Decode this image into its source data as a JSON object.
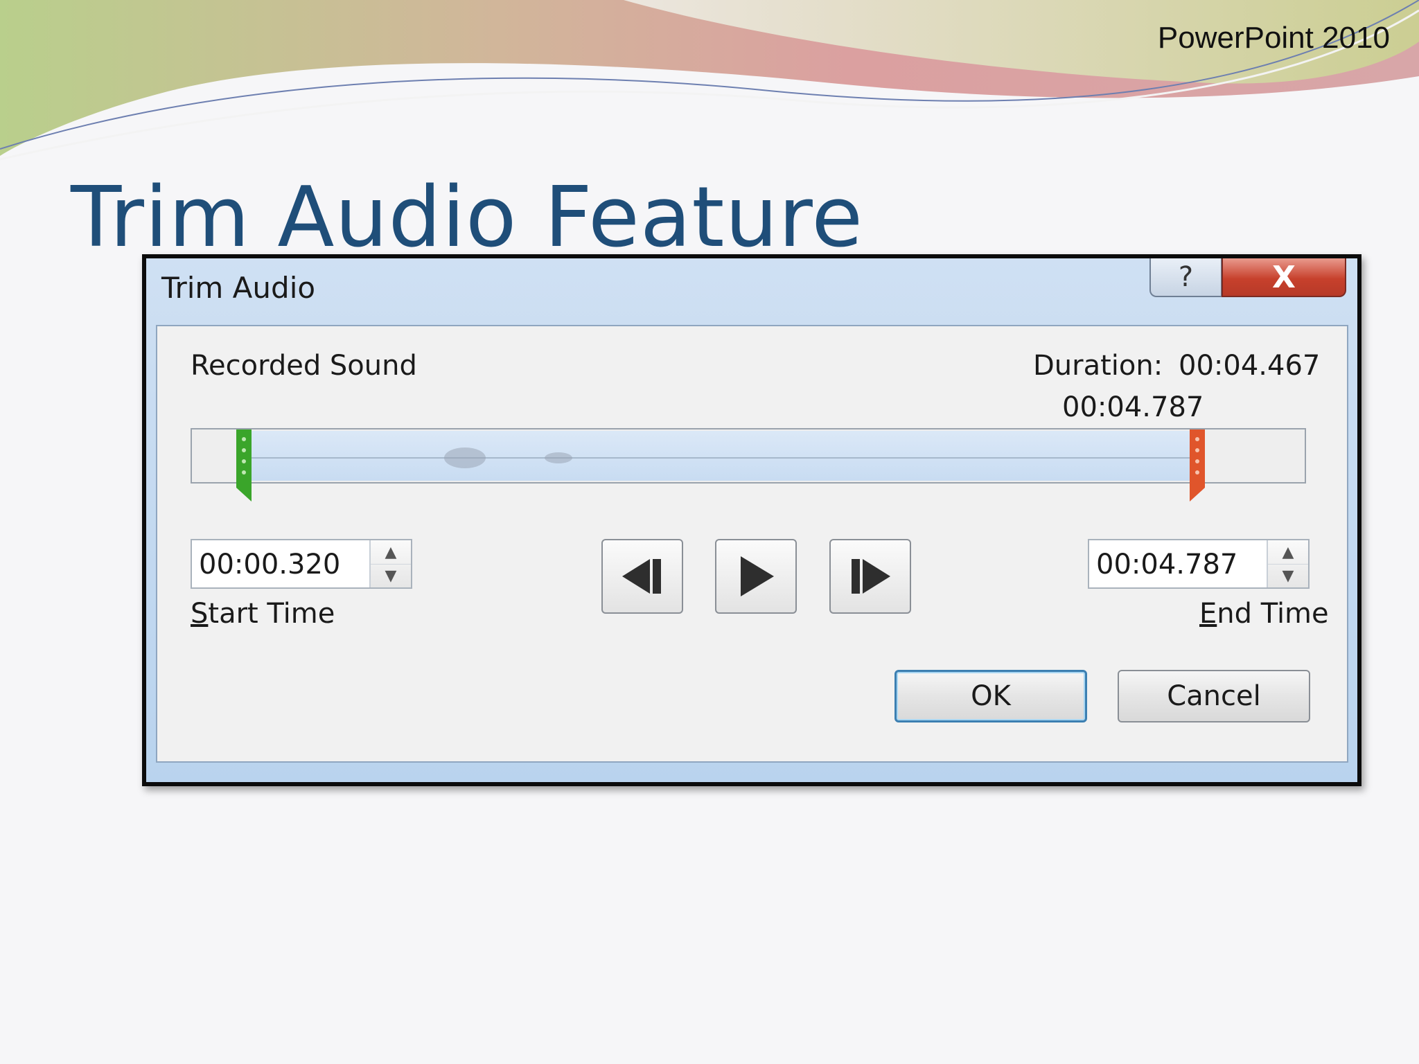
{
  "slide": {
    "brand": "PowerPoint 2010",
    "title": "Trim Audio Feature"
  },
  "dialog": {
    "title": "Trim Audio",
    "help_icon": "?",
    "close_icon": "X",
    "clip_name": "Recorded Sound",
    "duration_label": "Duration:",
    "duration_value": "00:04.467",
    "marker_time": "00:04.787",
    "start_time": {
      "value": "00:00.320",
      "label_mnemonic": "S",
      "label_rest": "tart Time"
    },
    "end_time": {
      "value": "00:04.787",
      "label_mnemonic": "E",
      "label_rest": "nd Time"
    },
    "transport": {
      "previous_frame_icon": "previous-frame-icon",
      "play_icon": "play-icon",
      "next_frame_icon": "next-frame-icon"
    },
    "ok_label": "OK",
    "cancel_label": "Cancel"
  },
  "colors": {
    "title_blue": "#1f4e79",
    "start_marker": "#3aa52a",
    "end_marker": "#e0552b",
    "selection": "#c8dcf2"
  }
}
